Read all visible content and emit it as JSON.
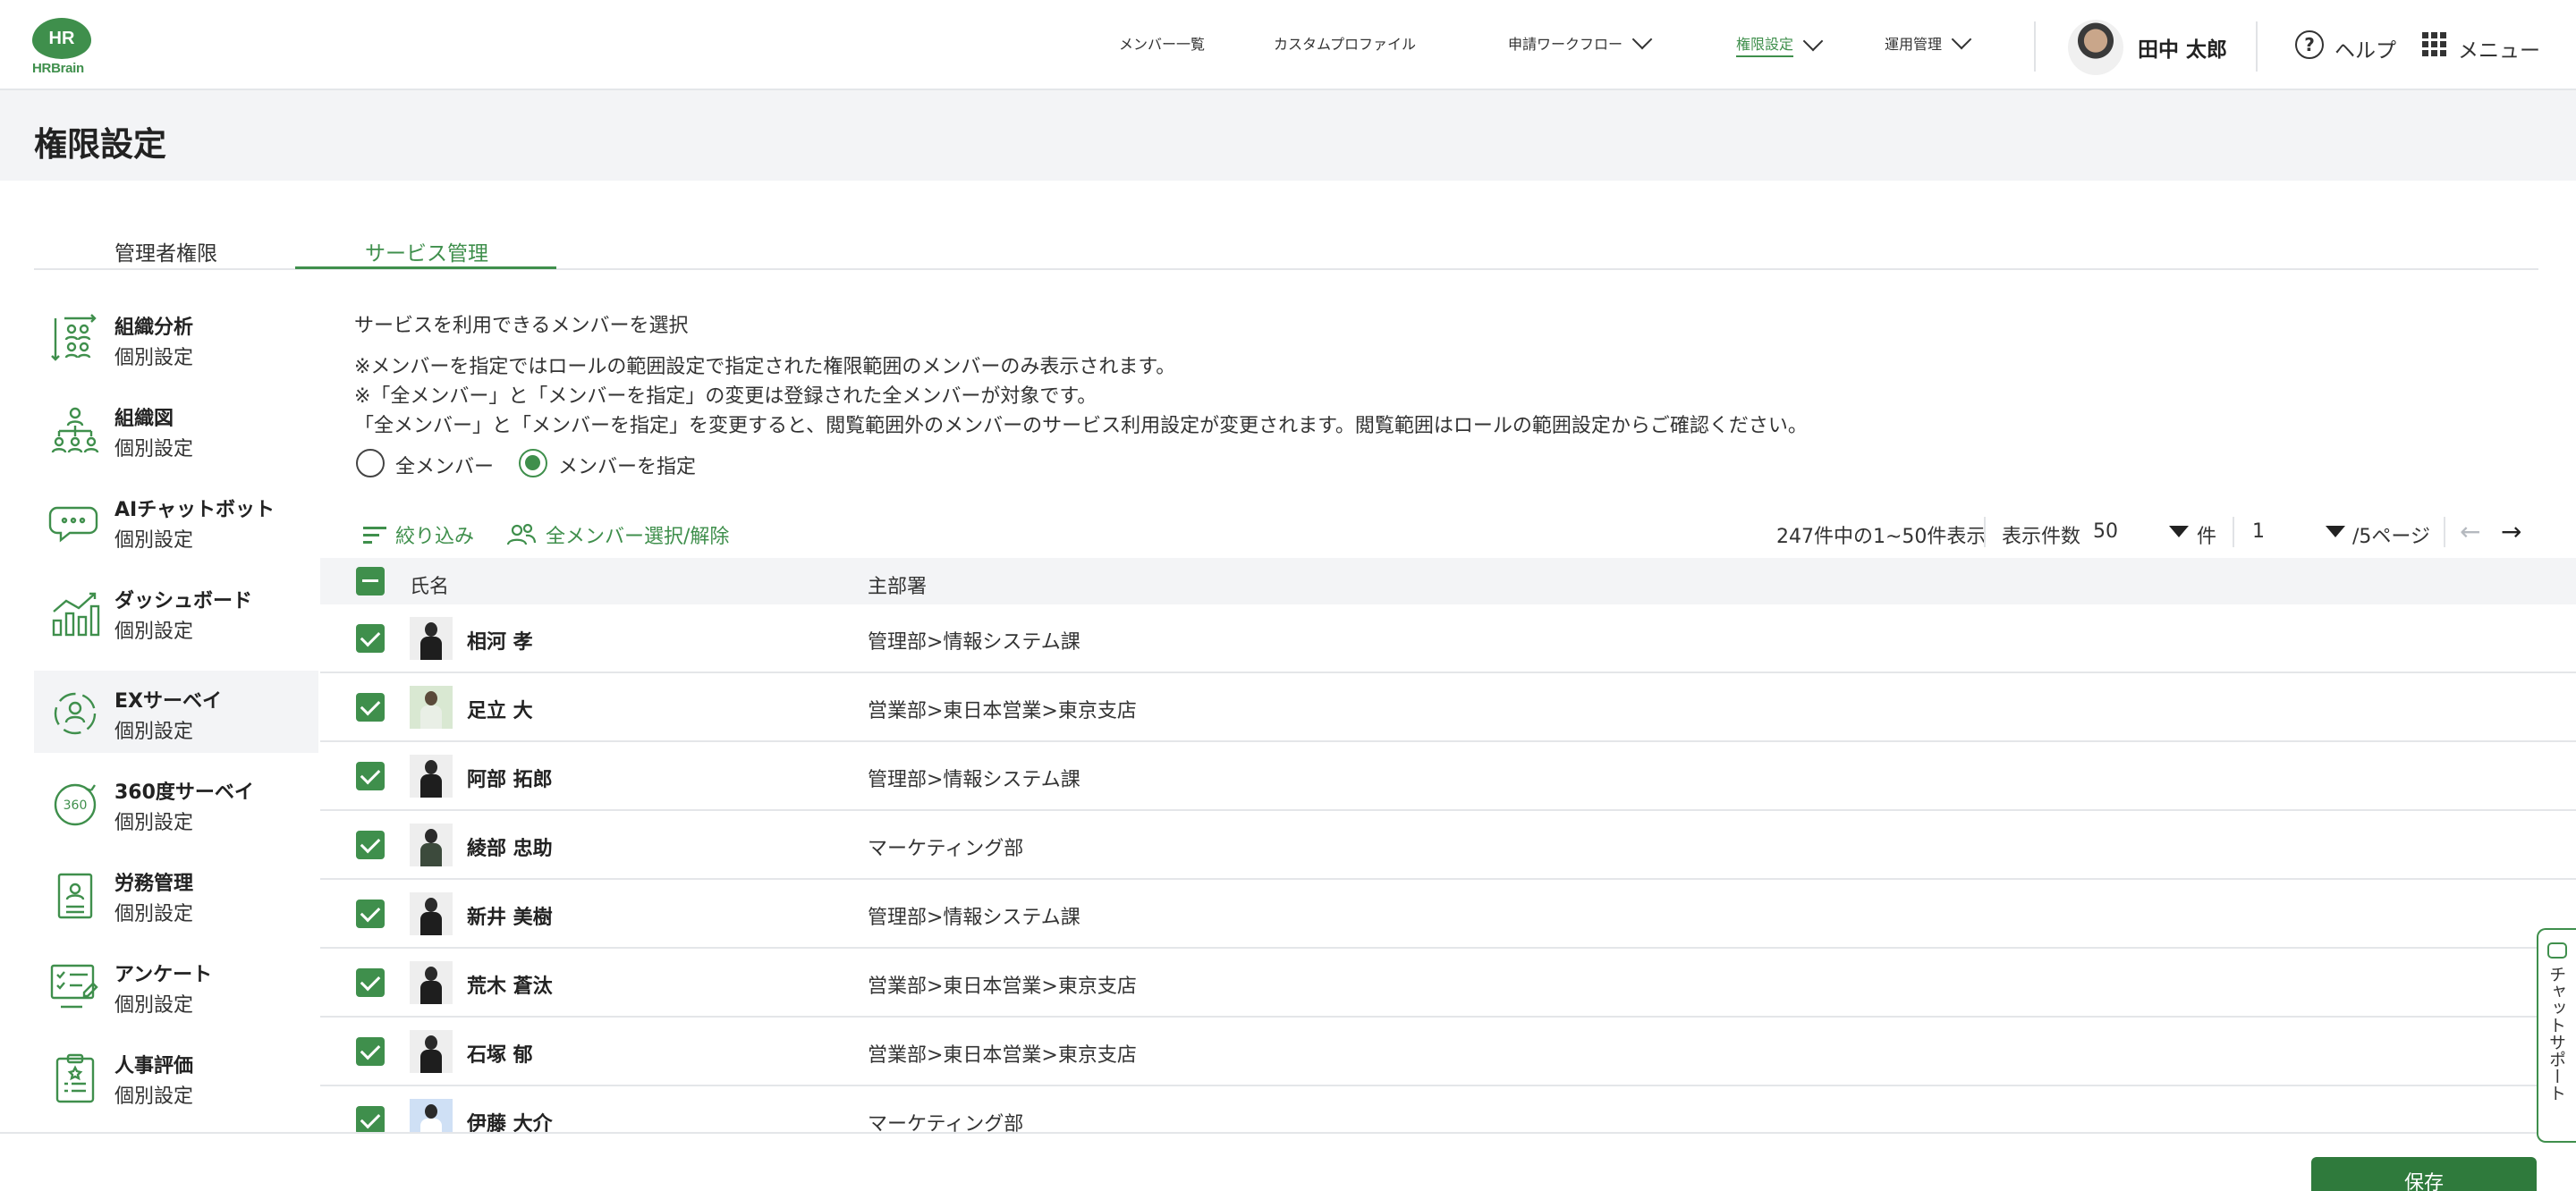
{
  "app": {
    "logo_top": "HR",
    "logo_text": "HRBrain",
    "accent": "#3f8f4c"
  },
  "nav": {
    "items": [
      {
        "label": "メンバー一覧"
      },
      {
        "label": "カスタムプロファイル"
      },
      {
        "label": "申請ワークフロー"
      },
      {
        "label": "権限設定"
      },
      {
        "label": "運用管理"
      }
    ],
    "user_name": "田中 太郎",
    "help_label": "ヘルプ",
    "menu_label": "メニュー"
  },
  "page_title": "権限設定",
  "tabs": [
    {
      "label": "管理者権限"
    },
    {
      "label": "サービス管理"
    }
  ],
  "sidebar": {
    "items": [
      {
        "title": "組織分析",
        "sub": "個別設定"
      },
      {
        "title": "組織図",
        "sub": "個別設定"
      },
      {
        "title": "AIチャットボット",
        "sub": "個別設定"
      },
      {
        "title": "ダッシュボード",
        "sub": "個別設定"
      },
      {
        "title": "EXサーベイ",
        "sub": "個別設定"
      },
      {
        "title": "360度サーベイ",
        "sub": "個別設定"
      },
      {
        "title": "労務管理",
        "sub": "個別設定"
      },
      {
        "title": "アンケート",
        "sub": "個別設定"
      },
      {
        "title": "人事評価",
        "sub": "個別設定"
      }
    ]
  },
  "content": {
    "heading": "サービスを利用できるメンバーを選択",
    "notes": [
      "※メンバーを指定ではロールの範囲設定で指定された権限範囲のメンバーのみ表示されます。",
      "※「全メンバー」と「メンバーを指定」の変更は登録された全メンバーが対象です。",
      "「全メンバー」と「メンバーを指定」を変更すると、閲覧範囲外のメンバーのサービス利用設定が変更されます。閲覧範囲はロールの範囲設定からご確認ください。"
    ],
    "radio_all": "全メンバー",
    "radio_specify": "メンバーを指定",
    "filter_label": "絞り込み",
    "select_all_label": "全メンバー選択/解除",
    "pager": {
      "summary": "247件中の1~50件表示",
      "per_page_label": "表示件数",
      "per_page_value": "50",
      "per_page_unit": "件",
      "page_value": "1",
      "page_total": "/5ページ"
    },
    "columns": {
      "name": "氏名",
      "dept": "主部署"
    },
    "rows": [
      {
        "name": "相河 孝",
        "dept": "管理部>情報システム課"
      },
      {
        "name": "足立 大",
        "dept": "営業部>東日本営業>東京支店"
      },
      {
        "name": "阿部 拓郎",
        "dept": "管理部>情報システム課"
      },
      {
        "name": "綾部 忠助",
        "dept": "マーケティング部"
      },
      {
        "name": "新井 美樹",
        "dept": "管理部>情報システム課"
      },
      {
        "name": "荒木 蒼汰",
        "dept": "営業部>東日本営業>東京支店"
      },
      {
        "name": "石塚 郁",
        "dept": "営業部>東日本営業>東京支店"
      },
      {
        "name": "伊藤 大介",
        "dept": "マーケティング部"
      }
    ]
  },
  "footer": {
    "save_label": "保存"
  },
  "chat_support": {
    "label": "チャットサポート"
  }
}
